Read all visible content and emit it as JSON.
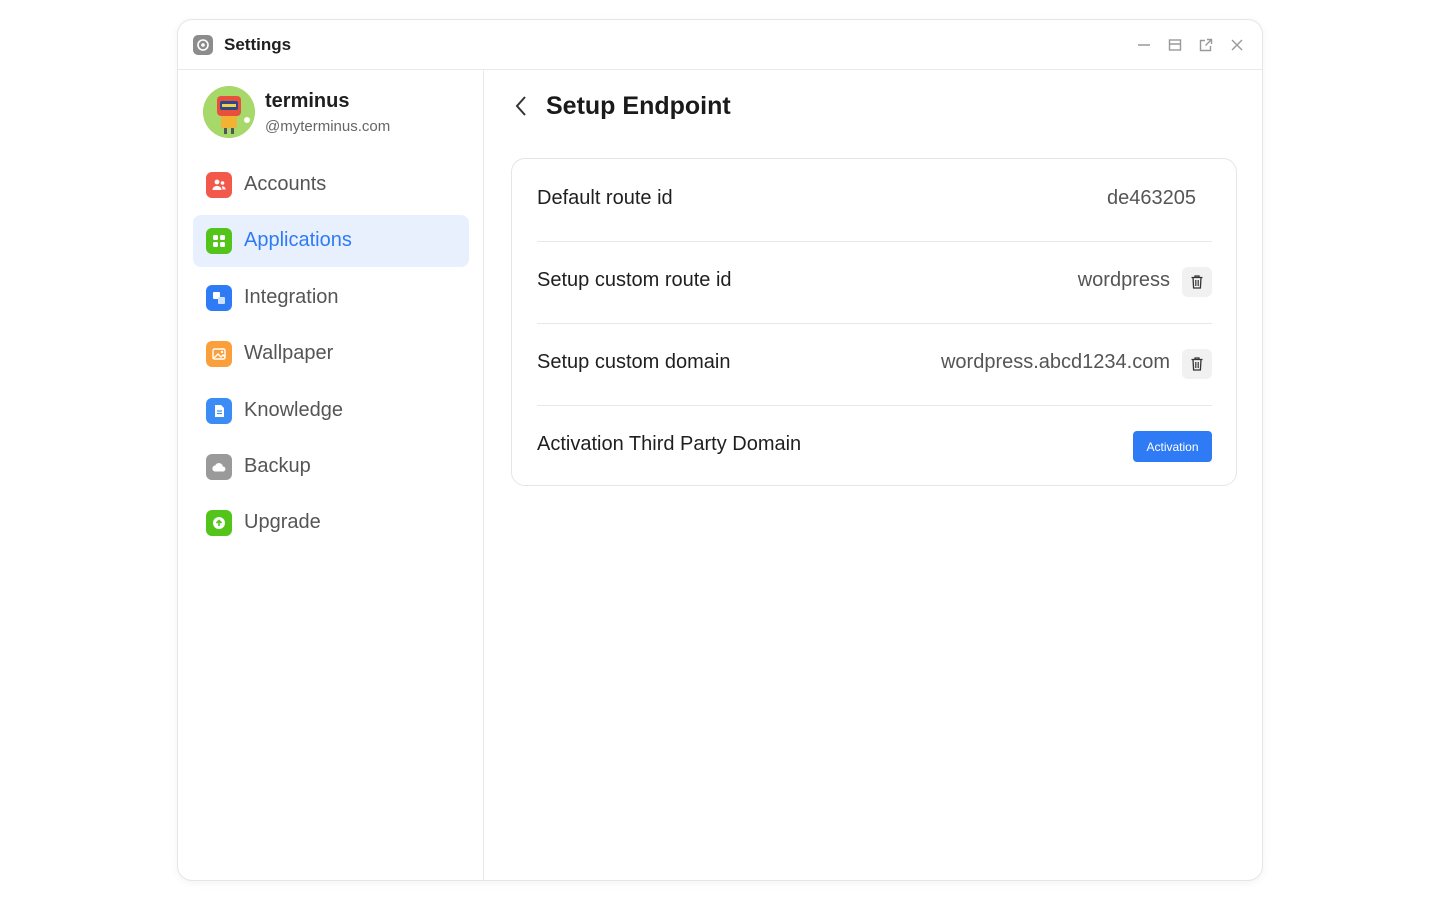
{
  "window": {
    "title": "Settings",
    "controls": [
      "minimize-icon",
      "maximize-icon",
      "popout-icon",
      "close-icon"
    ]
  },
  "profile": {
    "name": "terminus",
    "handle": "@myterminus.com"
  },
  "sidebar": {
    "items": [
      {
        "label": "Accounts",
        "icon": "accounts-icon",
        "color": "#f2594b",
        "active": false
      },
      {
        "label": "Applications",
        "icon": "applications-icon",
        "color": "#52c41a",
        "active": true
      },
      {
        "label": "Integration",
        "icon": "integration-icon",
        "color": "#2f7bf5",
        "active": false
      },
      {
        "label": "Wallpaper",
        "icon": "wallpaper-icon",
        "color": "#fa9f3c",
        "active": false
      },
      {
        "label": "Knowledge",
        "icon": "knowledge-icon",
        "color": "#3b8df5",
        "active": false
      },
      {
        "label": "Backup",
        "icon": "backup-icon",
        "color": "#9a9a9a",
        "active": false
      },
      {
        "label": "Upgrade",
        "icon": "upgrade-icon",
        "color": "#52c41a",
        "active": false
      }
    ]
  },
  "main": {
    "title": "Setup Endpoint",
    "rows": [
      {
        "label": "Default route id",
        "value": "de463205"
      },
      {
        "label": "Setup custom route id",
        "value": "wordpress"
      },
      {
        "label": "Setup custom domain",
        "value": "wordpress.abcd1234.com"
      },
      {
        "label": "Activation Third Party Domain",
        "button": "Activation"
      }
    ]
  },
  "colors": {
    "accent": "#2f7bf5",
    "active_bg": "#e8f0fd"
  }
}
